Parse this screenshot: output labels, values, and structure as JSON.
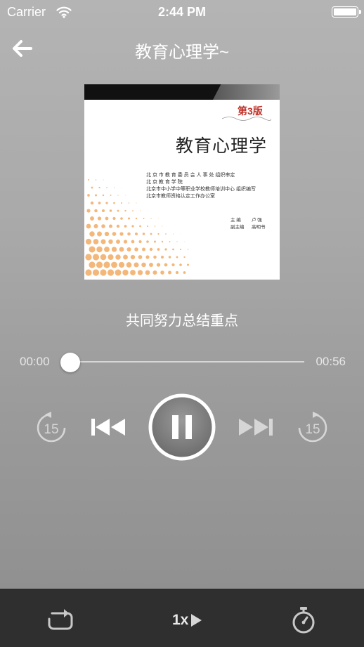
{
  "status_bar": {
    "carrier": "Carrier",
    "time": "2:44 PM"
  },
  "nav": {
    "title": "教育心理学~"
  },
  "cover": {
    "edition": "第3版",
    "title": "教育心理学",
    "lines": [
      "北 京 市 教 育 委 员 会 人 事 处 组织审定",
      "北     京     教     育     学     院",
      "北京市中小学中等职业学校教师培训中心 组织编写",
      "北京市教师资格认定工作办公室"
    ],
    "editor_label": "主  编",
    "editor_name": "卢  强",
    "deputy_label": "副主编",
    "deputy_name": "高明书"
  },
  "track": {
    "name": "共同努力总结重点"
  },
  "playback": {
    "elapsed": "00:00",
    "total": "00:56",
    "progress": 0
  },
  "controls": {
    "rewind_seconds": "15",
    "forward_seconds": "15",
    "state": "playing"
  },
  "bottom_bar": {
    "speed": "1x"
  },
  "icons": {
    "back": "arrow-left-icon",
    "rewind": "rewind-15-icon",
    "previous": "skip-previous-icon",
    "pause": "pause-icon",
    "next": "skip-next-icon",
    "forward": "forward-15-icon",
    "repeat": "repeat-icon",
    "speed": "play-speed-icon",
    "timer": "stopwatch-icon"
  }
}
